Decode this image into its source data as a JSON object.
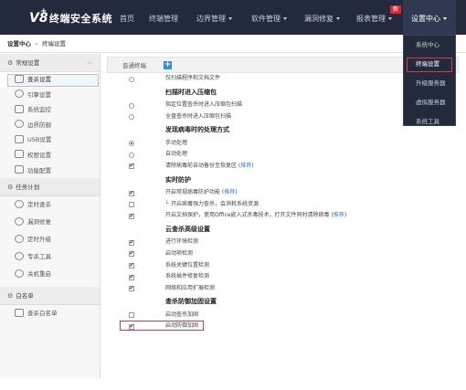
{
  "app": {
    "logo_mark": "V8",
    "logo_plus": "+",
    "logo_text": "终端安全系统"
  },
  "nav": {
    "home": "首页",
    "terminal": "终端管理",
    "border": "边界管理",
    "software": "软件管理",
    "vuln": "漏洞修复",
    "report": "报表管理",
    "settings": "设置中心",
    "new_badge": "新"
  },
  "dropdown": {
    "items": [
      "系统中心",
      "终端设置",
      "升级服务器",
      "虚拟服务器",
      "系统工具"
    ]
  },
  "breadcrumb": {
    "root": "设置中心",
    "sep": "»",
    "current": "终端设置"
  },
  "sidebar": {
    "groups": [
      {
        "title": "常规设置",
        "items": [
          "查杀设置",
          "引擎设置",
          "系统监控",
          "边界防御",
          "USB设置",
          "权限设置",
          "功能配置"
        ]
      },
      {
        "title": "任务计划",
        "items": [
          "定时查杀",
          "漏洞修复",
          "定时升级",
          "专杀工具",
          "关机重启"
        ]
      },
      {
        "title": "白名单",
        "items": [
          "查杀白名单"
        ]
      }
    ]
  },
  "main": {
    "col_header": "普通终端",
    "add_button": "+",
    "rows": [
      {
        "kind": "radio",
        "on": false,
        "text": "仅扫描程序和文档文件"
      },
      {
        "kind": "head",
        "text": "扫描时进入压缩包"
      },
      {
        "kind": "radio",
        "on": false,
        "text": "指定位置查杀时进入压缩包扫描"
      },
      {
        "kind": "radio",
        "on": false,
        "text": "全盘查杀时进入压缩包扫描"
      },
      {
        "kind": "head",
        "text": "发现病毒时的处理方式"
      },
      {
        "kind": "radio",
        "on": true,
        "text": "手动处理"
      },
      {
        "kind": "radio",
        "on": false,
        "text": "自动处理"
      },
      {
        "kind": "check",
        "on": true,
        "text": "清除病毒前自动备份至恢复区",
        "link": "推荐"
      },
      {
        "kind": "head",
        "text": "实时防护"
      },
      {
        "kind": "check",
        "on": true,
        "text": "开启常规病毒防护功能",
        "link": "推荐"
      },
      {
        "kind": "sub",
        "text": "开启病毒强力查杀，会消耗系统资源"
      },
      {
        "kind": "check",
        "on": true,
        "text": "开启文档保护，使用Office嵌入式杀毒技术，打开文件同时清除病毒",
        "link": "推荐"
      },
      {
        "kind": "head",
        "text": "云查杀高级设置"
      },
      {
        "kind": "check",
        "on": true,
        "text": "进行环境检测"
      },
      {
        "kind": "check",
        "on": true,
        "text": "启动项检测"
      },
      {
        "kind": "check",
        "on": true,
        "text": "系统关键位置检测"
      },
      {
        "kind": "check",
        "on": true,
        "text": "系统插件修复检测"
      },
      {
        "kind": "check",
        "on": true,
        "text": "网络和应用扩展检测"
      },
      {
        "kind": "head",
        "text": "查杀防御加固设置"
      },
      {
        "kind": "check",
        "on": false,
        "text": "启动查杀加固"
      },
      {
        "kind": "check",
        "on": true,
        "text": "启动防御加固"
      }
    ]
  }
}
